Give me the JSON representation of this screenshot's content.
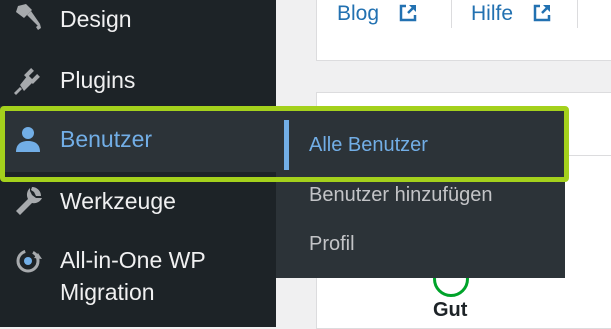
{
  "sidebar": {
    "items": [
      {
        "label": "Design",
        "icon": "brush-icon"
      },
      {
        "label": "Plugins",
        "icon": "plug-icon"
      },
      {
        "label": "Benutzer",
        "icon": "user-icon",
        "active": true
      },
      {
        "label": "Werkzeuge",
        "icon": "wrench-icon"
      },
      {
        "label": "All-in-One WP Migration",
        "label_line1": "All-in-One WP",
        "label_line2": "Migration",
        "icon": "migration-icon"
      }
    ]
  },
  "submenu": {
    "items": [
      {
        "label": "Alle Benutzer",
        "active": true
      },
      {
        "label": "Benutzer hinzufügen"
      },
      {
        "label": "Profil"
      }
    ]
  },
  "header": {
    "links": [
      {
        "label": "Blog",
        "icon": "external-link-icon"
      },
      {
        "label": "Hilfe",
        "icon": "external-link-icon"
      }
    ]
  },
  "card": {
    "status_label": "Gut"
  },
  "colors": {
    "sidebar_bg": "#1d2327",
    "submenu_bg": "#2c3338",
    "active_text": "#72aee6",
    "link": "#2271b1",
    "highlight_frame": "#a4d11c",
    "status_good": "#00a32a"
  }
}
